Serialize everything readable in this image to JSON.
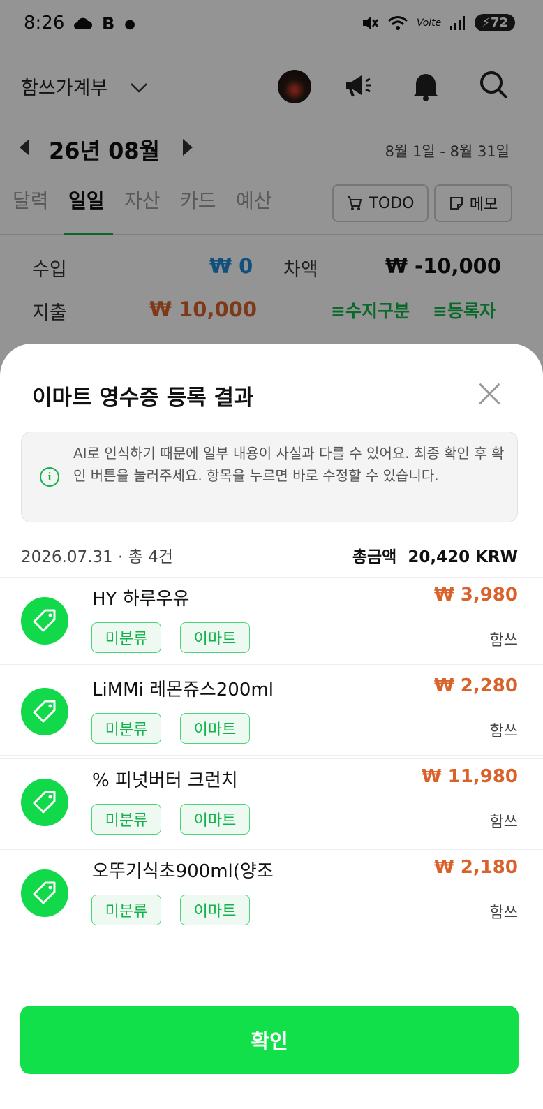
{
  "status_bar": {
    "time": "8:26",
    "left_icons": [
      "cloud-icon",
      "b-icon",
      "dot-icon"
    ],
    "battery": "72"
  },
  "header": {
    "book_name": "함쓰가계부"
  },
  "month": {
    "label": "26년 08월",
    "range": "8월 1일 - 8월 31일"
  },
  "tabs": [
    {
      "label": "달력",
      "active": false
    },
    {
      "label": "일일",
      "active": true
    },
    {
      "label": "자산",
      "active": false
    },
    {
      "label": "카드",
      "active": false
    },
    {
      "label": "예산",
      "active": false
    }
  ],
  "tab_buttons": {
    "todo": "TODO",
    "memo": "메모"
  },
  "summary": {
    "income_label": "수입",
    "income_value": "₩ 0",
    "diff_label": "차액",
    "diff_value": "₩ -10,000",
    "expense_label": "지출",
    "expense_value": "₩ 10,000",
    "filter_category": "수지구분",
    "filter_registrant": "등록자"
  },
  "sheet": {
    "title": "이마트 영수증 등록 결과",
    "notice": "AI로 인식하기 때문에 일부 내용이 사실과 다를 수 있어요. 최종 확인 후 확인 버튼을 눌러주세요. 항목을 누르면 바로 수정할 수 있습니다.",
    "date_count": "2026.07.31 · 총 4건",
    "total": "총금액  20,420 KRW",
    "items": [
      {
        "name": "HY 하루우유",
        "price": "₩ 3,980",
        "category": "미분류",
        "store": "이마트",
        "payer": "함쓰"
      },
      {
        "name": "LiMMi 레몬쥬스200ml",
        "price": "₩ 2,280",
        "category": "미분류",
        "store": "이마트",
        "payer": "함쓰"
      },
      {
        "name": "% 피넛버터 크런치",
        "price": "₩ 11,980",
        "category": "미분류",
        "store": "이마트",
        "payer": "함쓰"
      },
      {
        "name": "오뚜기식초900ml(양조",
        "price": "₩ 2,180",
        "category": "미분류",
        "store": "이마트",
        "payer": "함쓰"
      }
    ],
    "confirm_label": "확인"
  },
  "colors": {
    "accent_green": "#12b34a",
    "button_green": "#12e04a",
    "income_blue": "#1e88d6",
    "expense_orange": "#d9622b"
  }
}
